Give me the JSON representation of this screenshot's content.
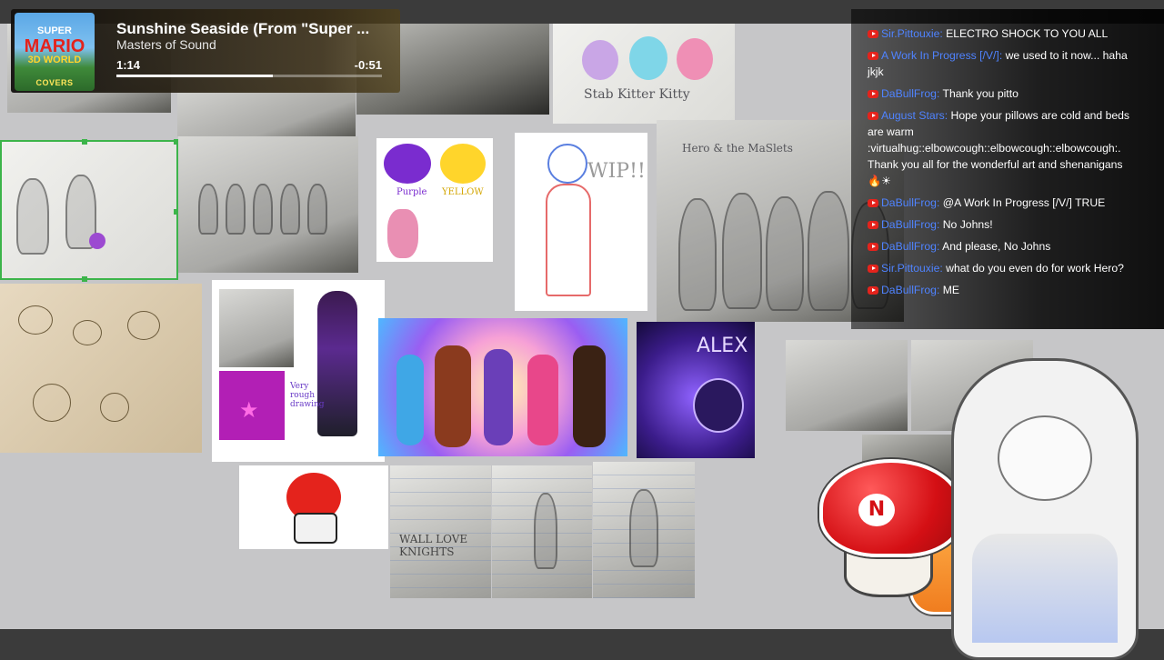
{
  "music_widget": {
    "album_line1": "SUPER",
    "album_line2": "MARIO",
    "album_line3": "3D WORLD",
    "album_badge": "COVERS",
    "title": "Sunshine Seaside (From \"Super ...",
    "artist": "Masters of Sound",
    "elapsed": "1:14",
    "remaining": "-0:51",
    "progress_percent": 59
  },
  "artwork_labels": {
    "kitty_card": "Stab Kitter Kitty",
    "hero_header": "Hero & the MaSlets",
    "wip_label": "WIP!!",
    "purple_label": "Purple",
    "yellow_label": "YELLOW",
    "rough_label": "Very rough drawing",
    "alex_label": "ALEX",
    "wall_label": "WALL LOVE KNIGHTS"
  },
  "chat": {
    "messages": [
      {
        "author": "Sir.Pittouxie",
        "text": "ELECTRO SHOCK TO YOU ALL"
      },
      {
        "author": "A Work In Progress [/V/]",
        "text": "we used to it now... haha jkjk"
      },
      {
        "author": "DaBullFrog",
        "text": "Thank you pitto"
      },
      {
        "author": "August Stars",
        "text": "Hope your pillows are cold and beds are warm :virtualhug::elbowcough::elbowcough::elbowcough:. Thank you all for the wonderful art and shenanigans 🔥☀"
      },
      {
        "author": "DaBullFrog",
        "text": "@A Work In Progress [/V/] TRUE"
      },
      {
        "author": "DaBullFrog",
        "text": "No Johns!"
      },
      {
        "author": "DaBullFrog",
        "text": "And please, No Johns"
      },
      {
        "author": "Sir.Pittouxie",
        "text": "what do you even do for work Hero?"
      },
      {
        "author": "DaBullFrog",
        "text": "ME"
      }
    ]
  },
  "mascot": {
    "mushroom_letter": "N"
  },
  "colors": {
    "board_bg": "#c6c6c8",
    "frame_bg": "#3b3b3b",
    "chat_author": "#4f83ff",
    "selection": "#3cb44a",
    "youtube_red": "#e4231c"
  }
}
